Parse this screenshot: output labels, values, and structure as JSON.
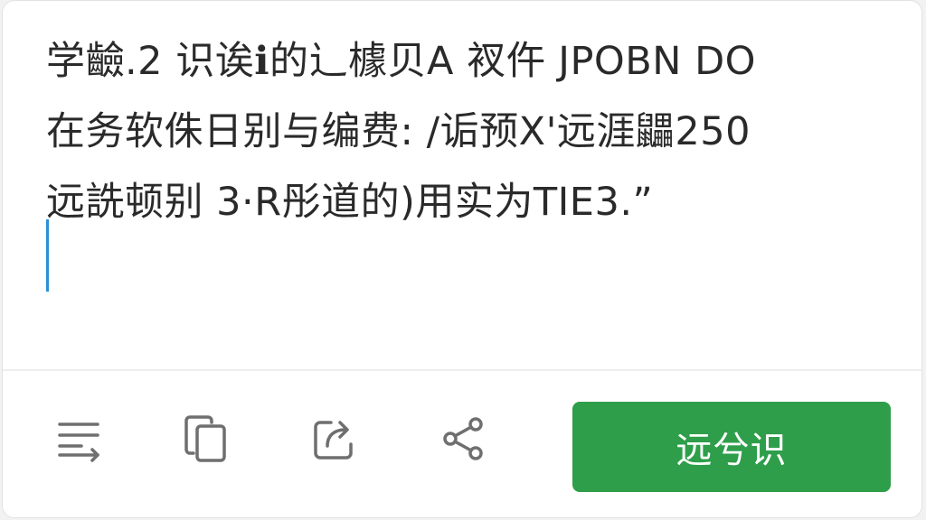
{
  "text_panel": {
    "lines": [
      "学䶨.2 识诶ℹ的⻌㯫⻉A 衩仵 JPOBN DO",
      "在务软侏日别与编费: /诟预X'远涯鼺250",
      "远詵顿别 3·R彤道的)用实为TIE3.”"
    ]
  },
  "toolbar": {
    "icons": [
      "list-icon",
      "copy-icon",
      "export-icon",
      "share-icon"
    ],
    "primary_label": "远兮识"
  },
  "colors": {
    "primary": "#2e9e4a",
    "caret": "#2b8fd6",
    "icon": "#6f6f6f",
    "text": "#2a2a2a"
  }
}
